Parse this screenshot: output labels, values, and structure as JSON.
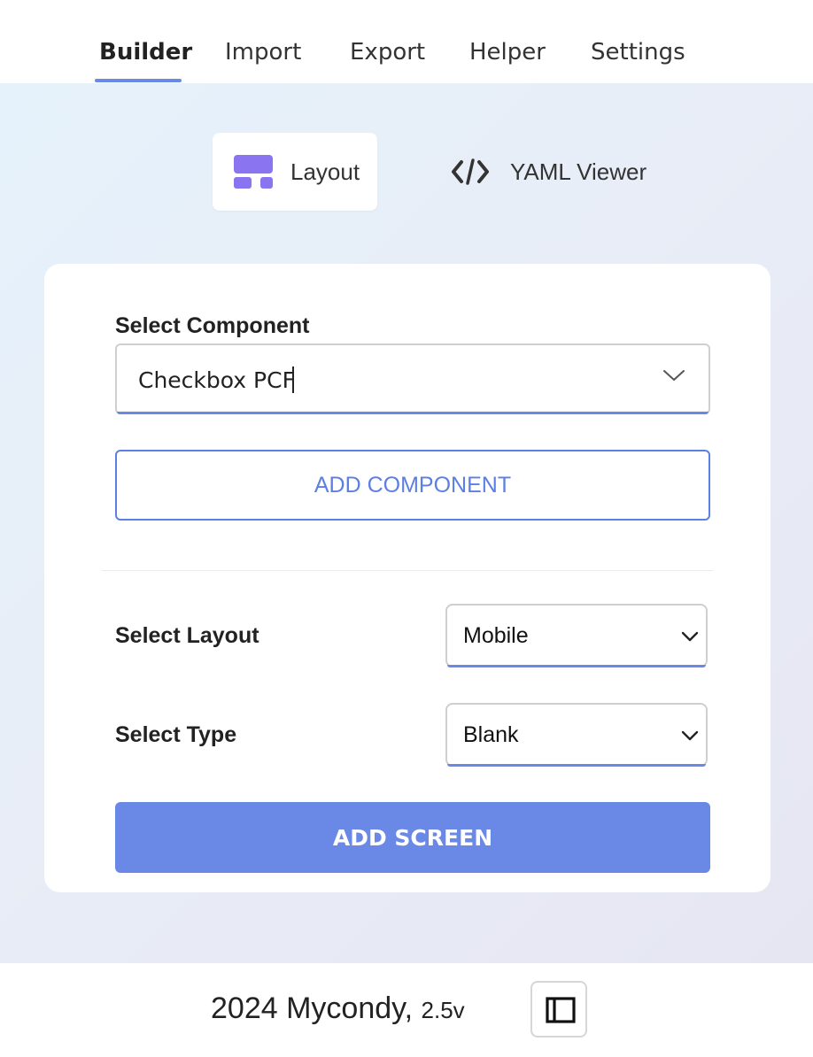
{
  "tabs": [
    {
      "label": "Builder",
      "active": true
    },
    {
      "label": "Import",
      "active": false
    },
    {
      "label": "Export",
      "active": false
    },
    {
      "label": "Helper",
      "active": false
    },
    {
      "label": "Settings",
      "active": false
    }
  ],
  "view_switch": {
    "layout": {
      "label": "Layout",
      "icon": "layout-icon",
      "selected": true
    },
    "yaml": {
      "label": "YAML Viewer",
      "icon": "code-icon",
      "selected": false
    }
  },
  "component": {
    "label": "Select Component",
    "value": "Checkbox PCF",
    "icon": "chevron-down-icon",
    "add_button": "ADD COMPONENT"
  },
  "screen": {
    "layout_label": "Select Layout",
    "layout_value": "Mobile",
    "type_label": "Select Type",
    "type_value": "Blank",
    "add_button": "ADD SCREEN"
  },
  "footer": {
    "text": "2024 Mycondy,",
    "version": "2.5v",
    "toggle_icon": "sidebar-toggle-icon"
  },
  "colors": {
    "accent": "#6a88e6",
    "layout_icon": "#8b74f0",
    "outline_button": "#5b7fe3"
  }
}
